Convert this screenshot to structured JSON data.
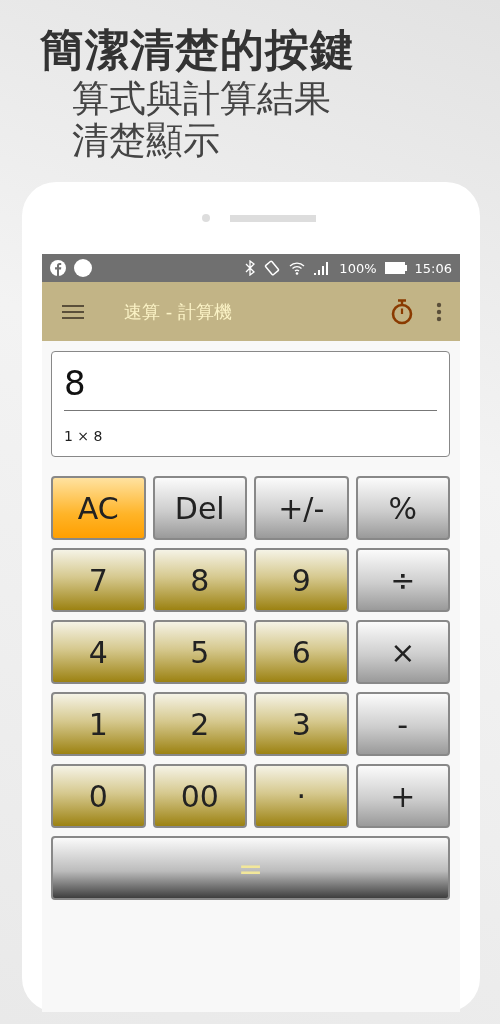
{
  "headline": {
    "title": "簡潔清楚的按鍵",
    "subtitle_lines": [
      "算式與計算結果",
      "清楚顯示"
    ]
  },
  "status_bar": {
    "battery_text": "100%",
    "time": "15:06"
  },
  "app_bar": {
    "title": "速算 - 計算機"
  },
  "display": {
    "result": "8",
    "expression": "1 × 8"
  },
  "keys": [
    {
      "label": "AC",
      "kind": "clear"
    },
    {
      "label": "Del",
      "kind": "op"
    },
    {
      "label": "+/-",
      "kind": "op"
    },
    {
      "label": "%",
      "kind": "op"
    },
    {
      "label": "7",
      "kind": "digit"
    },
    {
      "label": "8",
      "kind": "digit"
    },
    {
      "label": "9",
      "kind": "digit"
    },
    {
      "label": "÷",
      "kind": "op"
    },
    {
      "label": "4",
      "kind": "digit"
    },
    {
      "label": "5",
      "kind": "digit"
    },
    {
      "label": "6",
      "kind": "digit"
    },
    {
      "label": "×",
      "kind": "op"
    },
    {
      "label": "1",
      "kind": "digit"
    },
    {
      "label": "2",
      "kind": "digit"
    },
    {
      "label": "3",
      "kind": "digit"
    },
    {
      "label": "-",
      "kind": "op"
    },
    {
      "label": "0",
      "kind": "digit"
    },
    {
      "label": "00",
      "kind": "digit"
    },
    {
      "label": "·",
      "kind": "digit"
    },
    {
      "label": "+",
      "kind": "op"
    },
    {
      "label": "=",
      "kind": "equals"
    }
  ]
}
